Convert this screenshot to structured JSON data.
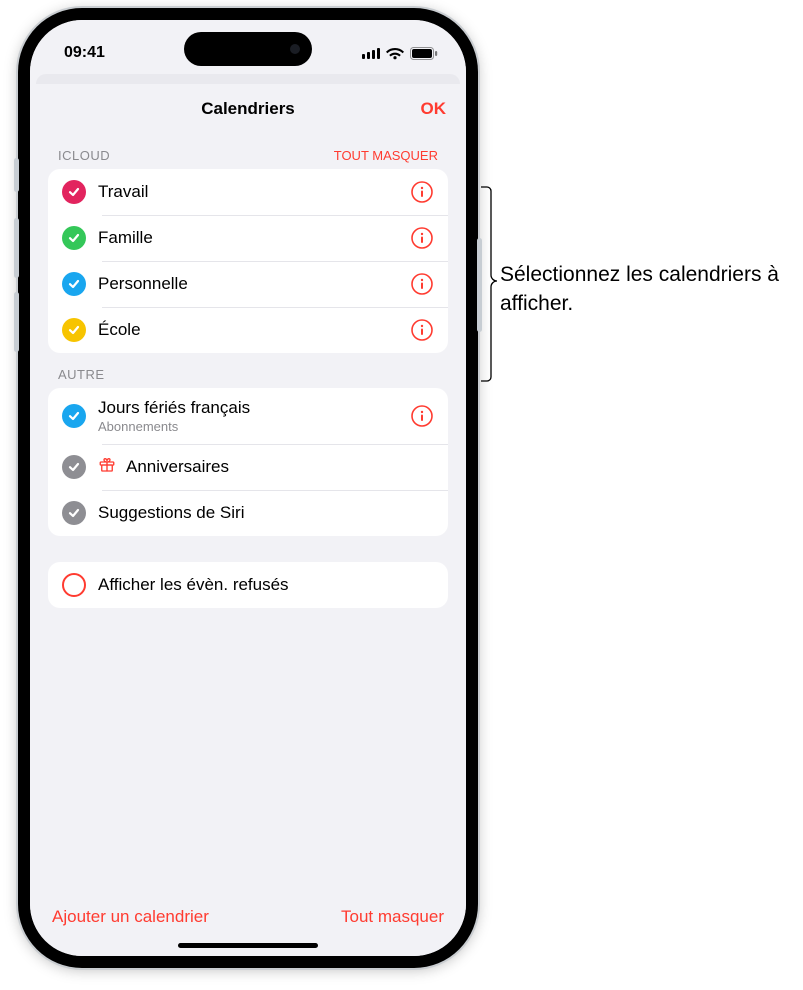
{
  "status": {
    "time": "09:41"
  },
  "sheet": {
    "title": "Calendriers",
    "done": "OK"
  },
  "sections": {
    "icloud": {
      "header": "ICLOUD",
      "action": "TOUT MASQUER",
      "items": [
        {
          "label": "Travail",
          "color": "#e2245e",
          "checked": true
        },
        {
          "label": "Famille",
          "color": "#34c759",
          "checked": true
        },
        {
          "label": "Personnelle",
          "color": "#19a6ef",
          "checked": true
        },
        {
          "label": "École",
          "color": "#f7c400",
          "checked": true
        }
      ]
    },
    "other": {
      "header": "AUTRE",
      "items": [
        {
          "label": "Jours fériés français",
          "sub": "Abonnements",
          "color": "#19a6ef",
          "checked": true,
          "info": true
        },
        {
          "label": "Anniversaires",
          "color": "#8e8e93",
          "checked": true,
          "info": false,
          "gift": true
        },
        {
          "label": "Suggestions de Siri",
          "color": "#8e8e93",
          "checked": true,
          "info": false
        }
      ]
    }
  },
  "declined": {
    "label": "Afficher les évèn. refusés",
    "checked": false
  },
  "footer": {
    "add": "Ajouter un calendrier",
    "hideAll": "Tout masquer"
  },
  "callout": "Sélectionnez les calendriers à afficher."
}
